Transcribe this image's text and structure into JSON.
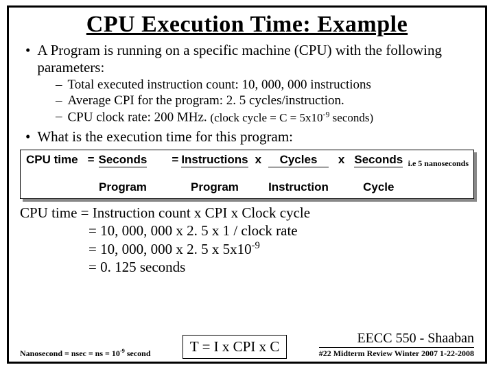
{
  "title": "CPU Execution Time: Example",
  "bullets": {
    "b1": "A Program is running on a specific machine (CPU) with the following parameters:",
    "s1": "Total executed instruction count:   10, 000, 000  instructions",
    "s2": "Average CPI for the program:   2. 5  cycles/instruction.",
    "s3a": "CPU clock rate:  200 MHz.  ",
    "s3b": "(clock cycle = C = 5x10",
    "s3c": " seconds)",
    "b2": "What is the execution time for this program:"
  },
  "ie_note": "i.e 5 nanoseconds",
  "formula": {
    "lhs": "CPU time",
    "eq": "=",
    "f1top": "Seconds",
    "f1bot": "Program",
    "f2top": "Instructions",
    "f2bot": "Program",
    "x": "x",
    "f3top": "Cycles",
    "f3bot": "Instruction",
    "f4top": "Seconds",
    "f4bot": "Cycle"
  },
  "calc": {
    "l1a": "CPU time =  Instruction count  x  CPI  x  Clock cycle",
    "l2": "=     10, 000, 000            x   2. 5  x   1 / clock rate",
    "l3a": "=     10, 000, 000            x   2. 5  x    5x10",
    "l4": "=     0. 125  seconds"
  },
  "footer": {
    "nano_a": "Nanosecond = nsec = ns = 10",
    "nano_b": " second",
    "tformula": "T =  I  x  CPI   x C",
    "course": "EECC 550 - Shaaban",
    "sub": "#22  Midterm Review  Winter 2007  1-22-2008"
  }
}
